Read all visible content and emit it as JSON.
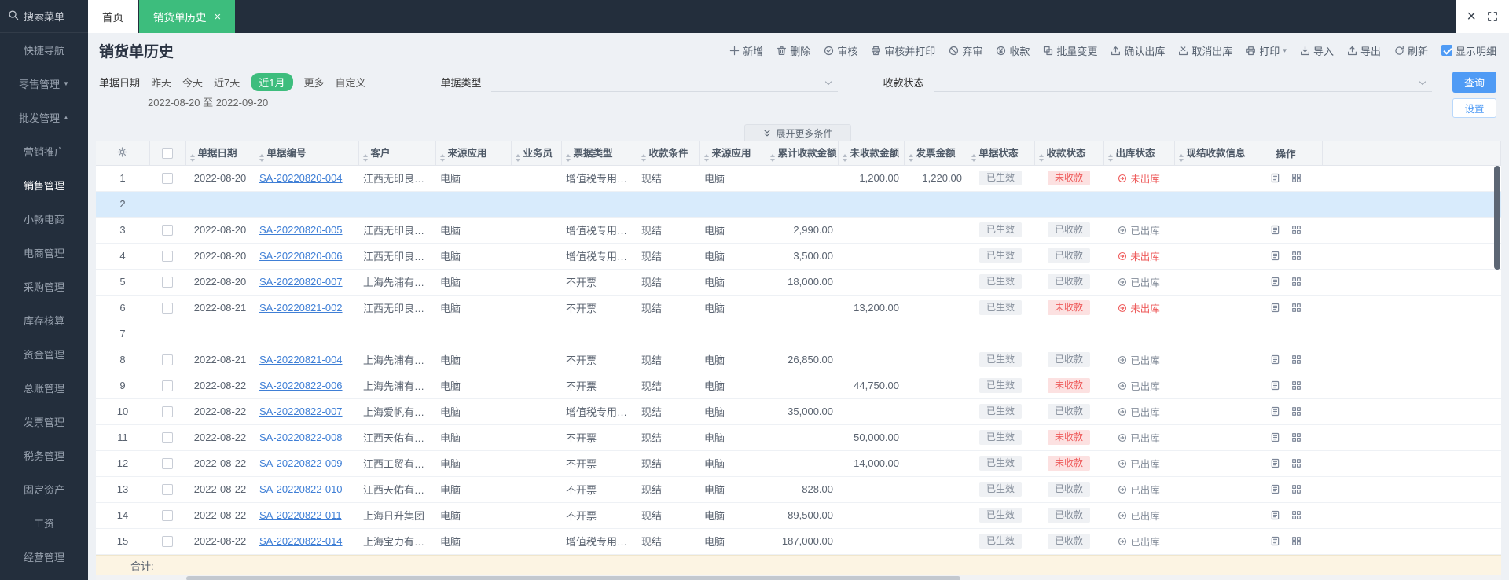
{
  "theme": {
    "sidebar_bg": "#232e3c",
    "active_tab_green": "#3dbd7d",
    "primary_blue": "#4f9bf5",
    "link_blue": "#3f7fd6",
    "danger_red": "#ee5b5b",
    "danger_bg": "#fce1e1",
    "status_gray_bg": "#eff1f4",
    "status_gray_text": "#848d9a",
    "selected_row_bg": "#d8ebfc",
    "sum_row_bg": "#fcf4e3",
    "header_bg": "#f3f5f7"
  },
  "sidebar": {
    "search_label": "搜索菜单",
    "items": [
      {
        "label": "快捷导航"
      },
      {
        "label": "零售管理",
        "arrow": "down"
      },
      {
        "label": "批发管理",
        "arrow": "up"
      },
      {
        "label": "营销推广",
        "sub": true
      },
      {
        "label": "销售管理",
        "sub": true,
        "active": true
      },
      {
        "label": "小畅电商"
      },
      {
        "label": "电商管理"
      },
      {
        "label": "采购管理"
      },
      {
        "label": "库存核算"
      },
      {
        "label": "资金管理"
      },
      {
        "label": "总账管理"
      },
      {
        "label": "发票管理"
      },
      {
        "label": "税务管理"
      },
      {
        "label": "固定资产"
      },
      {
        "label": "工资"
      },
      {
        "label": "经营管理"
      }
    ]
  },
  "tabs": [
    {
      "label": "首页",
      "active": false,
      "closable": false
    },
    {
      "label": "销货单历史",
      "active": true,
      "closable": true
    }
  ],
  "window_controls": {
    "close": "×"
  },
  "page": {
    "title": "销货单历史"
  },
  "toolbar": [
    {
      "name": "new",
      "label": "新增",
      "icon": "plus-icon"
    },
    {
      "name": "delete",
      "label": "删除",
      "icon": "trash-icon"
    },
    {
      "name": "audit",
      "label": "审核",
      "icon": "audit-icon"
    },
    {
      "name": "audit-print",
      "label": "审核并打印",
      "icon": "audit-print-icon"
    },
    {
      "name": "discard-audit",
      "label": "弃审",
      "icon": "discard-icon"
    },
    {
      "name": "collect-payment",
      "label": "收款",
      "icon": "payment-icon"
    },
    {
      "name": "batch-change",
      "label": "批量变更",
      "icon": "batch-icon"
    },
    {
      "name": "confirm-outbound",
      "label": "确认出库",
      "icon": "confirm-outbound-icon"
    },
    {
      "name": "cancel-outbound",
      "label": "取消出库",
      "icon": "cancel-outbound-icon"
    },
    {
      "name": "print",
      "label": "打印",
      "icon": "print-icon",
      "dropdown": true
    },
    {
      "name": "import",
      "label": "导入",
      "icon": "import-icon"
    },
    {
      "name": "export",
      "label": "导出",
      "icon": "export-icon"
    },
    {
      "name": "refresh",
      "label": "刷新",
      "icon": "refresh-icon"
    },
    {
      "name": "show-detail",
      "label": "显示明细",
      "icon": "checkbox-checked-icon",
      "checked": true
    }
  ],
  "filters": {
    "date_label": "单据日期",
    "quick_options": [
      "昨天",
      "今天",
      "近7天",
      "近1月",
      "更多",
      "自定义"
    ],
    "active_quick": "近1月",
    "date_range": "2022-08-20 至 2022-09-20",
    "doc_type_label": "单据类型",
    "payment_status_label": "收款状态",
    "query_button": "查询",
    "settings_button": "设置",
    "expand_more_label": "展开更多条件"
  },
  "table": {
    "columns": [
      {
        "key": "idx",
        "label": "",
        "icon": "gear-icon"
      },
      {
        "key": "check",
        "label": ""
      },
      {
        "key": "date",
        "label": "单据日期",
        "sortable": true
      },
      {
        "key": "doc_no",
        "label": "单据编号",
        "sortable": true
      },
      {
        "key": "customer",
        "label": "客户",
        "sortable": true
      },
      {
        "key": "source_app",
        "label": "来源应用",
        "sortable": true
      },
      {
        "key": "salesman",
        "label": "业务员",
        "sortable": true
      },
      {
        "key": "bill_type",
        "label": "票据类型",
        "sortable": true
      },
      {
        "key": "pay_condition",
        "label": "收款条件",
        "sortable": true
      },
      {
        "key": "source_app2",
        "label": "来源应用",
        "sortable": true
      },
      {
        "key": "received_total",
        "label": "累计收款金额",
        "sortable": true
      },
      {
        "key": "unreceived",
        "label": "未收款金额",
        "sortable": true
      },
      {
        "key": "invoice_amount",
        "label": "发票金额",
        "sortable": true
      },
      {
        "key": "doc_status",
        "label": "单据状态",
        "sortable": true
      },
      {
        "key": "pay_status",
        "label": "收款状态",
        "sortable": true
      },
      {
        "key": "out_status",
        "label": "出库状态",
        "sortable": true
      },
      {
        "key": "cash_info",
        "label": "现结收款信息",
        "sortable": true
      },
      {
        "key": "ops",
        "label": "操作"
      }
    ],
    "rows": [
      {
        "idx": 1,
        "date": "2022-08-20",
        "doc_no": "SA-20220820-004",
        "customer": "江西无印良品...",
        "source_app": "电脑",
        "salesman": "",
        "bill_type": "增值税专用发票",
        "pay_condition": "现结",
        "source_app2": "电脑",
        "received_total": "",
        "unreceived": "1,200.00",
        "invoice_amount": "1,220.00",
        "doc_status": "已生效",
        "pay_status": "未收款",
        "out_status": "未出库",
        "cash_info": ""
      },
      {
        "idx": 2,
        "empty": true,
        "selected": true
      },
      {
        "idx": 3,
        "date": "2022-08-20",
        "doc_no": "SA-20220820-005",
        "customer": "江西无印良品...",
        "source_app": "电脑",
        "salesman": "",
        "bill_type": "增值税专用发票",
        "pay_condition": "现结",
        "source_app2": "电脑",
        "received_total": "2,990.00",
        "unreceived": "",
        "invoice_amount": "",
        "doc_status": "已生效",
        "pay_status": "已收款",
        "out_status": "已出库",
        "cash_info": ""
      },
      {
        "idx": 4,
        "date": "2022-08-20",
        "doc_no": "SA-20220820-006",
        "customer": "江西无印良品...",
        "source_app": "电脑",
        "salesman": "",
        "bill_type": "增值税专用发票",
        "pay_condition": "现结",
        "source_app2": "电脑",
        "received_total": "3,500.00",
        "unreceived": "",
        "invoice_amount": "",
        "doc_status": "已生效",
        "pay_status": "已收款",
        "out_status": "未出库",
        "cash_info": ""
      },
      {
        "idx": 5,
        "date": "2022-08-20",
        "doc_no": "SA-20220820-007",
        "customer": "上海先浦有限...",
        "source_app": "电脑",
        "salesman": "",
        "bill_type": "不开票",
        "pay_condition": "现结",
        "source_app2": "电脑",
        "received_total": "18,000.00",
        "unreceived": "",
        "invoice_amount": "",
        "doc_status": "已生效",
        "pay_status": "已收款",
        "out_status": "已出库",
        "cash_info": ""
      },
      {
        "idx": 6,
        "date": "2022-08-21",
        "doc_no": "SA-20220821-002",
        "customer": "江西无印良品...",
        "source_app": "电脑",
        "salesman": "",
        "bill_type": "不开票",
        "pay_condition": "现结",
        "source_app2": "电脑",
        "received_total": "",
        "unreceived": "13,200.00",
        "invoice_amount": "",
        "doc_status": "已生效",
        "pay_status": "未收款",
        "out_status": "未出库",
        "cash_info": ""
      },
      {
        "idx": 7,
        "empty": true
      },
      {
        "idx": 8,
        "date": "2022-08-21",
        "doc_no": "SA-20220821-004",
        "customer": "上海先浦有限...",
        "source_app": "电脑",
        "salesman": "",
        "bill_type": "不开票",
        "pay_condition": "现结",
        "source_app2": "电脑",
        "received_total": "26,850.00",
        "unreceived": "",
        "invoice_amount": "",
        "doc_status": "已生效",
        "pay_status": "已收款",
        "out_status": "已出库",
        "cash_info": ""
      },
      {
        "idx": 9,
        "date": "2022-08-22",
        "doc_no": "SA-20220822-006",
        "customer": "上海先浦有限...",
        "source_app": "电脑",
        "salesman": "",
        "bill_type": "不开票",
        "pay_condition": "现结",
        "source_app2": "电脑",
        "received_total": "",
        "unreceived": "44,750.00",
        "invoice_amount": "",
        "doc_status": "已生效",
        "pay_status": "未收款",
        "out_status": "已出库",
        "cash_info": ""
      },
      {
        "idx": 10,
        "date": "2022-08-22",
        "doc_no": "SA-20220822-007",
        "customer": "上海爱帆有限...",
        "source_app": "电脑",
        "salesman": "",
        "bill_type": "增值税专用发票",
        "pay_condition": "现结",
        "source_app2": "电脑",
        "received_total": "35,000.00",
        "unreceived": "",
        "invoice_amount": "",
        "doc_status": "已生效",
        "pay_status": "已收款",
        "out_status": "已出库",
        "cash_info": ""
      },
      {
        "idx": 11,
        "date": "2022-08-22",
        "doc_no": "SA-20220822-008",
        "customer": "江西天佑有限...",
        "source_app": "电脑",
        "salesman": "",
        "bill_type": "不开票",
        "pay_condition": "现结",
        "source_app2": "电脑",
        "received_total": "",
        "unreceived": "50,000.00",
        "invoice_amount": "",
        "doc_status": "已生效",
        "pay_status": "未收款",
        "out_status": "已出库",
        "cash_info": ""
      },
      {
        "idx": 12,
        "date": "2022-08-22",
        "doc_no": "SA-20220822-009",
        "customer": "江西工贸有限...",
        "source_app": "电脑",
        "salesman": "",
        "bill_type": "不开票",
        "pay_condition": "现结",
        "source_app2": "电脑",
        "received_total": "",
        "unreceived": "14,000.00",
        "invoice_amount": "",
        "doc_status": "已生效",
        "pay_status": "未收款",
        "out_status": "已出库",
        "cash_info": ""
      },
      {
        "idx": 13,
        "date": "2022-08-22",
        "doc_no": "SA-20220822-010",
        "customer": "江西天佑有限...",
        "source_app": "电脑",
        "salesman": "",
        "bill_type": "不开票",
        "pay_condition": "现结",
        "source_app2": "电脑",
        "received_total": "828.00",
        "unreceived": "",
        "invoice_amount": "",
        "doc_status": "已生效",
        "pay_status": "已收款",
        "out_status": "已出库",
        "cash_info": ""
      },
      {
        "idx": 14,
        "date": "2022-08-22",
        "doc_no": "SA-20220822-011",
        "customer": "上海日升集团",
        "source_app": "电脑",
        "salesman": "",
        "bill_type": "不开票",
        "pay_condition": "现结",
        "source_app2": "电脑",
        "received_total": "89,500.00",
        "unreceived": "",
        "invoice_amount": "",
        "doc_status": "已生效",
        "pay_status": "已收款",
        "out_status": "已出库",
        "cash_info": ""
      },
      {
        "idx": 15,
        "date": "2022-08-22",
        "doc_no": "SA-20220822-014",
        "customer": "上海宝力有限...",
        "source_app": "电脑",
        "salesman": "",
        "bill_type": "增值税专用发票",
        "pay_condition": "现结",
        "source_app2": "电脑",
        "received_total": "187,000.00",
        "unreceived": "",
        "invoice_amount": "",
        "doc_status": "已生效",
        "pay_status": "已收款",
        "out_status": "已出库",
        "cash_info": ""
      }
    ],
    "sum_label": "合计:"
  }
}
